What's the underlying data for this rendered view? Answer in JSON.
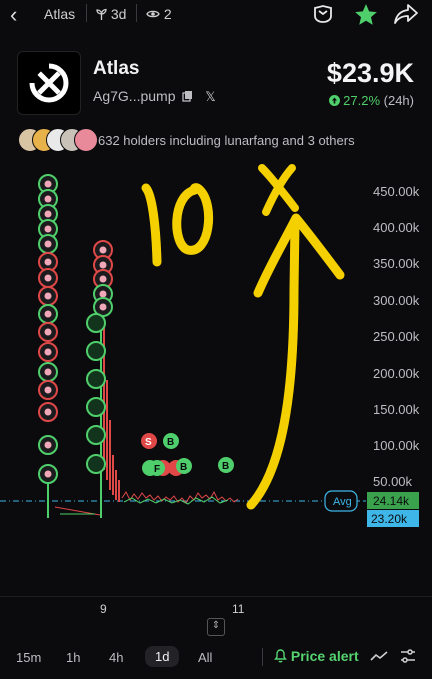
{
  "topbar": {
    "token_name": "Atlas",
    "age": "3d",
    "watchers": "2"
  },
  "token": {
    "name": "Atlas",
    "address": "Ag7G...pump",
    "price": "$23.9K",
    "change_pct": "27.2%",
    "change_period": "(24h)"
  },
  "holders": {
    "summary": "632 holders including lunarfang and 3 others"
  },
  "chart_data": {
    "type": "line",
    "y_ticks": [
      "450.00k",
      "400.00k",
      "350.00k",
      "300.00k",
      "250.00k",
      "200.00k",
      "150.00k",
      "100.00k",
      "50.00k"
    ],
    "x_ticks": [
      "9",
      "11"
    ],
    "avg_label": "Avg",
    "price_tags": [
      "24.14k",
      "23.20k"
    ],
    "trade_markers": [
      "S",
      "B",
      "F",
      "B",
      "B"
    ],
    "annotation": "10x",
    "colors": {
      "up": "#4fcf6b",
      "down": "#e04848",
      "avg": "#3fb6e8",
      "annotation": "#f5d000"
    }
  },
  "timeframes": [
    "15m",
    "1h",
    "4h",
    "1d",
    "All"
  ],
  "active_timeframe": "1d",
  "price_alert": "Price alert"
}
